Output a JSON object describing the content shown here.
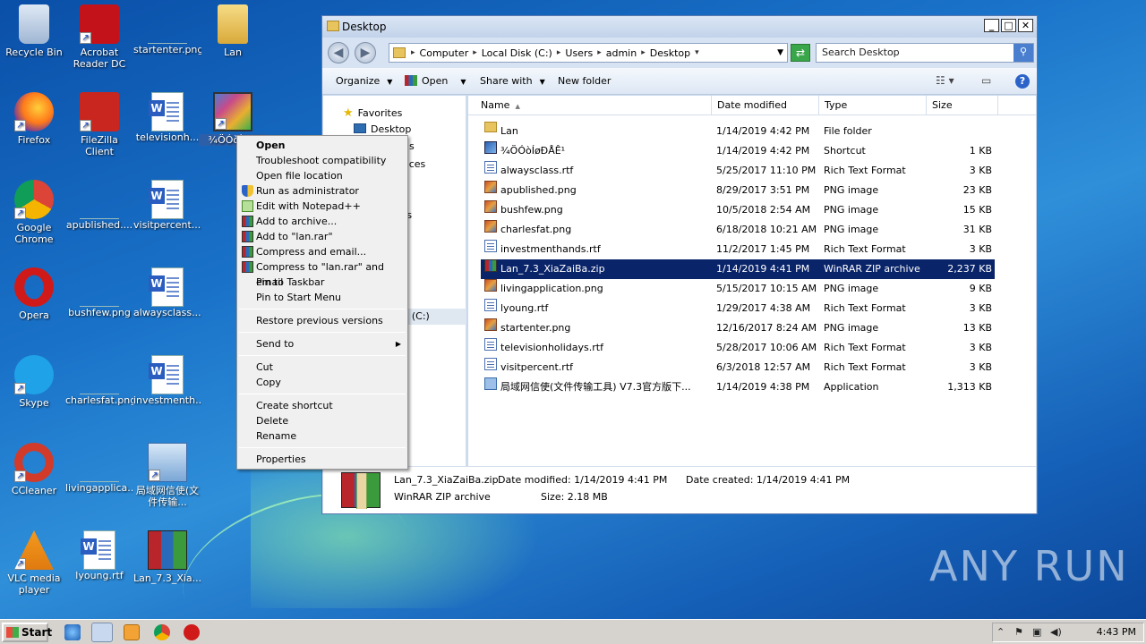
{
  "desktop_icons": [
    {
      "label": "Recycle Bin"
    },
    {
      "label": "Acrobat Reader DC"
    },
    {
      "label": "startenter.png"
    },
    {
      "label": "Lan"
    },
    {
      "label": "Firefox"
    },
    {
      "label": "FileZilla Client"
    },
    {
      "label": "televisionh..."
    },
    {
      "label": "¾ÖÓòÍø..."
    },
    {
      "label": "Google Chrome"
    },
    {
      "label": "apublished...."
    },
    {
      "label": "visitpercent...."
    },
    {
      "label": "Opera"
    },
    {
      "label": "bushfew.png"
    },
    {
      "label": "alwaysclass...."
    },
    {
      "label": "Skype"
    },
    {
      "label": "charlesfat.png"
    },
    {
      "label": "investmenth..."
    },
    {
      "label": "CCleaner"
    },
    {
      "label": "livingapplica..."
    },
    {
      "label": "局域网信使(文件传输..."
    },
    {
      "label": "VLC media player"
    },
    {
      "label": "lyoung.rtf"
    },
    {
      "label": "Lan_7.3_Xia..."
    }
  ],
  "window": {
    "title": "Desktop",
    "breadcrumb": [
      "Computer",
      "Local Disk (C:)",
      "Users",
      "admin",
      "Desktop"
    ],
    "search_placeholder": "Search Desktop",
    "toolbar": {
      "organize": "Organize",
      "open": "Open",
      "share_with": "Share with",
      "new_folder": "New folder"
    },
    "nav": {
      "favorites": "Favorites",
      "desktop": "Desktop",
      "frag1": "ds",
      "frag2": "aces",
      "frag3": "ts",
      "frag4": "k (C:)"
    },
    "columns": {
      "name": "Name",
      "date": "Date modified",
      "type": "Type",
      "size": "Size"
    },
    "files": [
      {
        "name": "Lan",
        "date": "1/14/2019 4:42 PM",
        "type": "File folder",
        "size": "",
        "icon": "folder"
      },
      {
        "name": "¾ÖÓòÍøÐÅÊ¹",
        "date": "1/14/2019 4:42 PM",
        "type": "Shortcut",
        "size": "1 KB",
        "icon": "lnk"
      },
      {
        "name": "alwaysclass.rtf",
        "date": "5/25/2017 11:10 PM",
        "type": "Rich Text Format",
        "size": "3 KB",
        "icon": "rtf"
      },
      {
        "name": "apublished.png",
        "date": "8/29/2017 3:51 PM",
        "type": "PNG image",
        "size": "23 KB",
        "icon": "png"
      },
      {
        "name": "bushfew.png",
        "date": "10/5/2018 2:54 AM",
        "type": "PNG image",
        "size": "15 KB",
        "icon": "png"
      },
      {
        "name": "charlesfat.png",
        "date": "6/18/2018 10:21 AM",
        "type": "PNG image",
        "size": "31 KB",
        "icon": "png"
      },
      {
        "name": "investmenthands.rtf",
        "date": "11/2/2017 1:45 PM",
        "type": "Rich Text Format",
        "size": "3 KB",
        "icon": "rtf"
      },
      {
        "name": "Lan_7.3_XiaZaiBa.zip",
        "date": "1/14/2019 4:41 PM",
        "type": "WinRAR ZIP archive",
        "size": "2,237 KB",
        "icon": "zip"
      },
      {
        "name": "livingapplication.png",
        "date": "5/15/2017 10:15 AM",
        "type": "PNG image",
        "size": "9 KB",
        "icon": "png"
      },
      {
        "name": "lyoung.rtf",
        "date": "1/29/2017 4:38 AM",
        "type": "Rich Text Format",
        "size": "3 KB",
        "icon": "rtf"
      },
      {
        "name": "startenter.png",
        "date": "12/16/2017 8:24 AM",
        "type": "PNG image",
        "size": "13 KB",
        "icon": "png"
      },
      {
        "name": "televisionholidays.rtf",
        "date": "5/28/2017 10:06 AM",
        "type": "Rich Text Format",
        "size": "3 KB",
        "icon": "rtf"
      },
      {
        "name": "visitpercent.rtf",
        "date": "6/3/2018 12:57 AM",
        "type": "Rich Text Format",
        "size": "3 KB",
        "icon": "rtf"
      },
      {
        "name": "局域网信使(文件传输工具) V7.3官方版下...",
        "date": "1/14/2019 4:38 PM",
        "type": "Application",
        "size": "1,313 KB",
        "icon": "app"
      }
    ],
    "selected_index": 7,
    "details": {
      "filename": "Lan_7.3_XiaZaiBa.zip",
      "date_modified": "Date modified: 1/14/2019 4:41 PM",
      "date_created": "Date created: 1/14/2019 4:41 PM",
      "type": "WinRAR ZIP archive",
      "size": "Size: 2.18 MB"
    }
  },
  "context_menu": {
    "items": [
      "Open",
      "Troubleshoot compatibility",
      "Open file location",
      "Run as administrator",
      "Edit with Notepad++",
      "Add to archive...",
      "Add to \"lan.rar\"",
      "Compress and email...",
      "Compress to \"lan.rar\" and email",
      "Pin to Taskbar",
      "Pin to Start Menu",
      "Restore previous versions",
      "Send to",
      "Cut",
      "Copy",
      "Create shortcut",
      "Delete",
      "Rename",
      "Properties"
    ]
  },
  "taskbar": {
    "start": "Start",
    "clock": "4:43 PM"
  },
  "watermark": "ANY RUN"
}
